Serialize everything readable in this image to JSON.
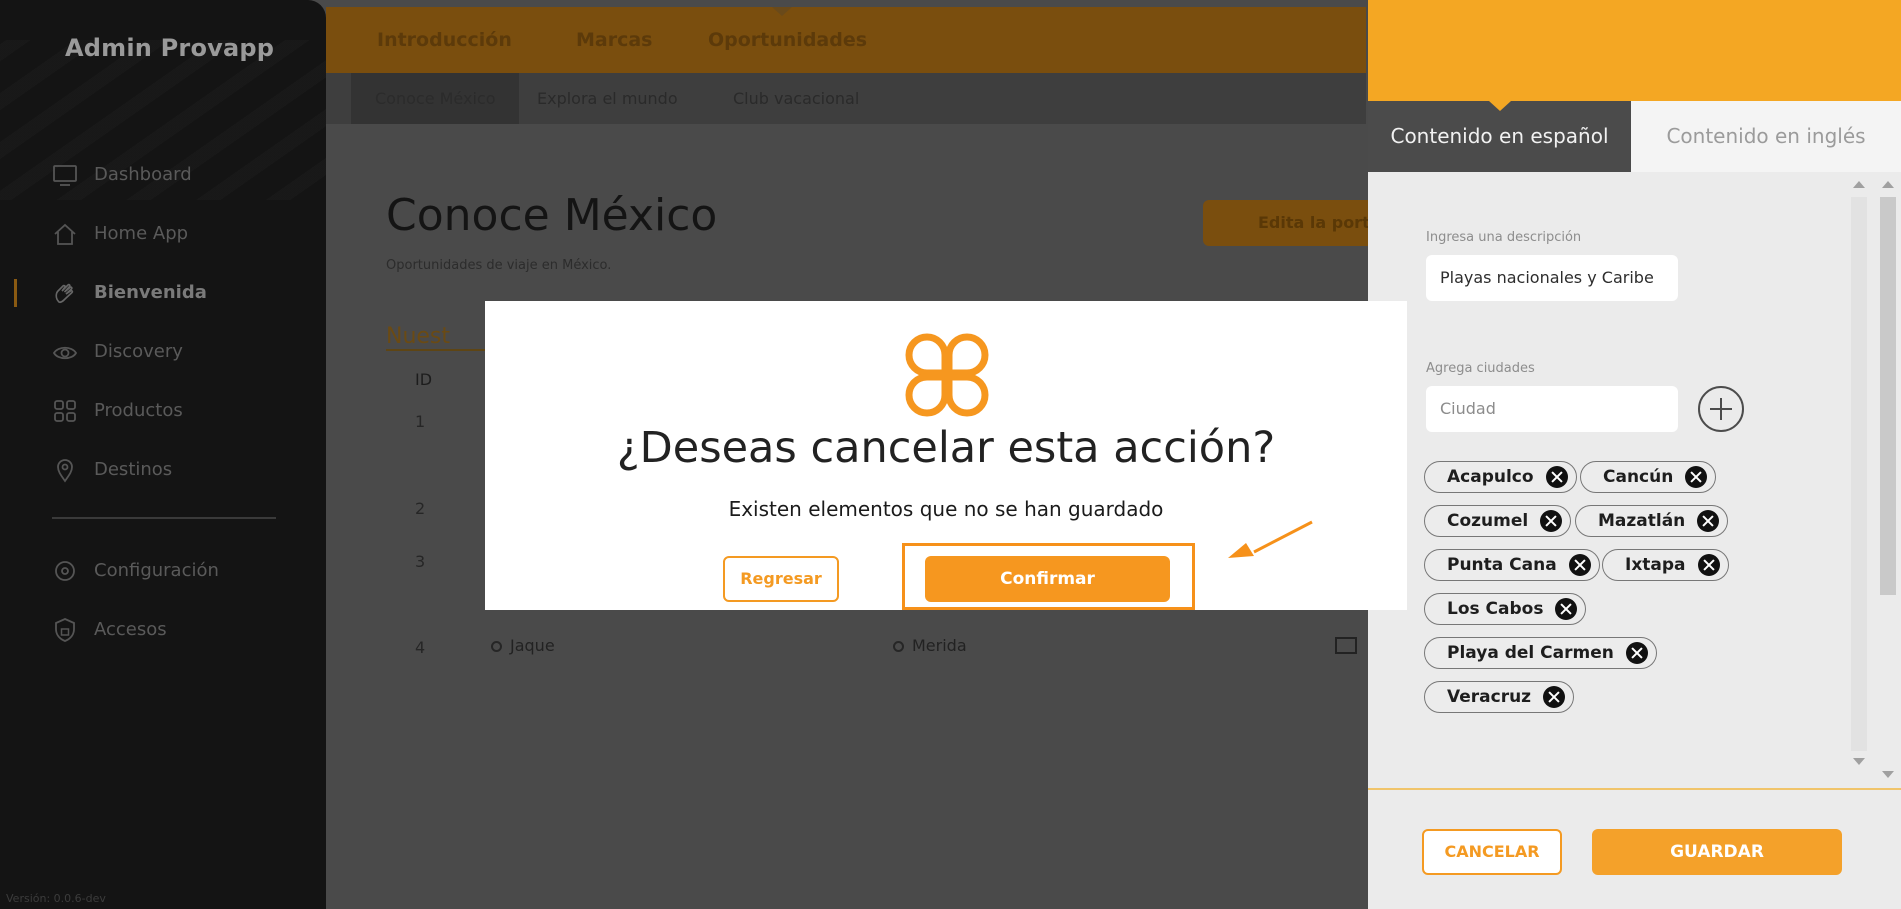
{
  "sidebar": {
    "brand": "Admin Provapp",
    "items": [
      {
        "label": "Dashboard",
        "icon": "monitor-icon"
      },
      {
        "label": "Home App",
        "icon": "home-icon"
      },
      {
        "label": "Bienvenida",
        "icon": "waving-hand-icon",
        "active": true
      },
      {
        "label": "Discovery",
        "icon": "eye-icon"
      },
      {
        "label": "Productos",
        "icon": "grid-icon"
      },
      {
        "label": "Destinos",
        "icon": "map-pin-icon"
      }
    ],
    "settings": [
      {
        "label": "Configuración",
        "icon": "gear-icon"
      },
      {
        "label": "Accesos",
        "icon": "shield-lock-icon"
      }
    ],
    "version": "Versión: 0.0.6-dev"
  },
  "topnav": {
    "tabs": [
      "Introducción",
      "Marcas",
      "Oportunidades"
    ],
    "active_tab": "Oportunidades"
  },
  "subnav": {
    "tabs": [
      "Conoce México",
      "Explora el mundo",
      "Club vacacional"
    ],
    "active_tab": "Conoce México"
  },
  "page": {
    "title": "Conoce México",
    "subtitle": "Oportunidades de viaje en México.",
    "edit_button": "Edita la port",
    "section_tab": "Nuest",
    "table": {
      "id_header": "ID",
      "row_ids": [
        "1",
        "2",
        "3",
        "4"
      ],
      "row4": {
        "name": "Jaque",
        "city": "Merida"
      }
    }
  },
  "panel": {
    "tabs": {
      "spanish": "Contenido en español",
      "english": "Contenido en inglés"
    },
    "description_label": "Ingresa una descripción",
    "description_value": "Playas nacionales y Caribe",
    "cities_label": "Agrega ciudades",
    "city_placeholder": "Ciudad",
    "cities": [
      "Acapulco",
      "Cancún",
      "Cozumel",
      "Mazatlán",
      "Punta Cana",
      "Ixtapa",
      "Los Cabos",
      "Playa del Carmen",
      "Veracruz"
    ],
    "cancel": "CANCELAR",
    "save": "GUARDAR"
  },
  "modal": {
    "title": "¿Deseas cancelar esta acción?",
    "message": "Existen elementos que no se han guardado",
    "back": "Regresar",
    "confirm": "Confirmar"
  },
  "colors": {
    "accent": "#f6971f",
    "panel_header": "#f4a723",
    "highlight": "#f6911a"
  }
}
